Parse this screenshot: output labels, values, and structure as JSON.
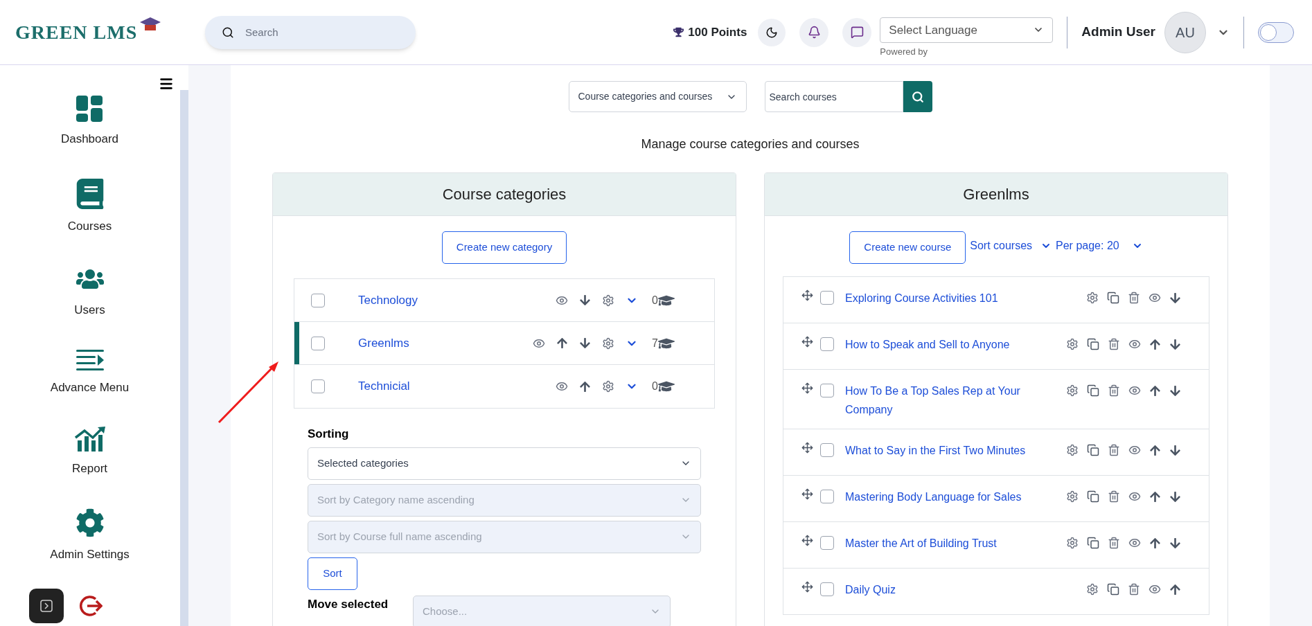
{
  "header": {
    "logo": "GREEN LMS",
    "search": {
      "placeholder": "Search"
    },
    "points": "100 Points",
    "language_select": {
      "value": "Select Language",
      "caption": "Powered by"
    },
    "user": {
      "name": "Admin User",
      "initials": "AU"
    },
    "theme_toggle": {
      "on": false
    }
  },
  "sidebar": {
    "items": [
      {
        "kind": "dashboard",
        "label": "Dashboard"
      },
      {
        "kind": "courses",
        "label": "Courses"
      },
      {
        "kind": "users",
        "label": "Users"
      },
      {
        "kind": "menu",
        "label": "Advance Menu"
      },
      {
        "kind": "report",
        "label": "Report"
      },
      {
        "kind": "settings",
        "label": "Admin Settings"
      },
      {
        "kind": "logout"
      }
    ]
  },
  "toolbar": {
    "view_select": "Course categories and courses",
    "search": {
      "placeholder": "Search courses"
    }
  },
  "heading": "Manage course categories and courses",
  "categories_panel": {
    "title": "Course categories",
    "create_button": "Create new category",
    "rows": [
      {
        "name": "Technology",
        "count": "0",
        "selected": false,
        "checked": false,
        "actions": [
          {
            "kind": "view"
          },
          {
            "kind": "down"
          },
          {
            "kind": "settings"
          },
          {
            "kind": "expand"
          }
        ]
      },
      {
        "name": "Greenlms",
        "count": "7",
        "selected": true,
        "checked": false,
        "actions": [
          {
            "kind": "view"
          },
          {
            "kind": "up"
          },
          {
            "kind": "down"
          },
          {
            "kind": "settings"
          },
          {
            "kind": "expand"
          }
        ]
      },
      {
        "name": "Technicial",
        "count": "0",
        "selected": false,
        "checked": false,
        "actions": [
          {
            "kind": "view"
          },
          {
            "kind": "up"
          },
          {
            "kind": "settings"
          },
          {
            "kind": "expand"
          }
        ]
      }
    ],
    "sorting": {
      "label": "Sorting",
      "selects": [
        {
          "value": "Selected categories",
          "disabled": false
        },
        {
          "value": "Sort by Category name ascending",
          "disabled": true
        },
        {
          "value": "Sort by Course full name ascending",
          "disabled": true
        }
      ],
      "button": "Sort"
    },
    "move": {
      "label": "Move selected",
      "value": "Choose...",
      "disabled": true
    }
  },
  "courses_panel": {
    "title": "Greenlms",
    "create_button": "Create new course",
    "sort_link": "Sort courses",
    "per_page": "Per page: 20",
    "rows": [
      {
        "name": "Exploring Course Activities 101",
        "checked": false,
        "actions": [
          {
            "kind": "settings"
          },
          {
            "kind": "copy"
          },
          {
            "kind": "delete"
          },
          {
            "kind": "view"
          },
          {
            "kind": "down"
          }
        ]
      },
      {
        "name": "How to Speak and Sell to Anyone",
        "checked": false,
        "actions": [
          {
            "kind": "settings"
          },
          {
            "kind": "copy"
          },
          {
            "kind": "delete"
          },
          {
            "kind": "view"
          },
          {
            "kind": "up"
          },
          {
            "kind": "down"
          }
        ]
      },
      {
        "name": "How To Be a Top Sales Rep at Your Company",
        "checked": false,
        "actions": [
          {
            "kind": "settings"
          },
          {
            "kind": "copy"
          },
          {
            "kind": "delete"
          },
          {
            "kind": "view"
          },
          {
            "kind": "up"
          },
          {
            "kind": "down"
          }
        ]
      },
      {
        "name": "What to Say in the First Two Minutes",
        "checked": false,
        "actions": [
          {
            "kind": "settings"
          },
          {
            "kind": "copy"
          },
          {
            "kind": "delete"
          },
          {
            "kind": "view"
          },
          {
            "kind": "up"
          },
          {
            "kind": "down"
          }
        ]
      },
      {
        "name": "Mastering Body Language for Sales",
        "checked": false,
        "actions": [
          {
            "kind": "settings"
          },
          {
            "kind": "copy"
          },
          {
            "kind": "delete"
          },
          {
            "kind": "view"
          },
          {
            "kind": "up"
          },
          {
            "kind": "down"
          }
        ]
      },
      {
        "name": "Master the Art of Building Trust",
        "checked": false,
        "actions": [
          {
            "kind": "settings"
          },
          {
            "kind": "copy"
          },
          {
            "kind": "delete"
          },
          {
            "kind": "view"
          },
          {
            "kind": "up"
          },
          {
            "kind": "down"
          }
        ]
      },
      {
        "name": "Daily Quiz",
        "checked": false,
        "actions": [
          {
            "kind": "settings"
          },
          {
            "kind": "copy"
          },
          {
            "kind": "delete"
          },
          {
            "kind": "view"
          },
          {
            "kind": "up"
          }
        ]
      }
    ]
  }
}
